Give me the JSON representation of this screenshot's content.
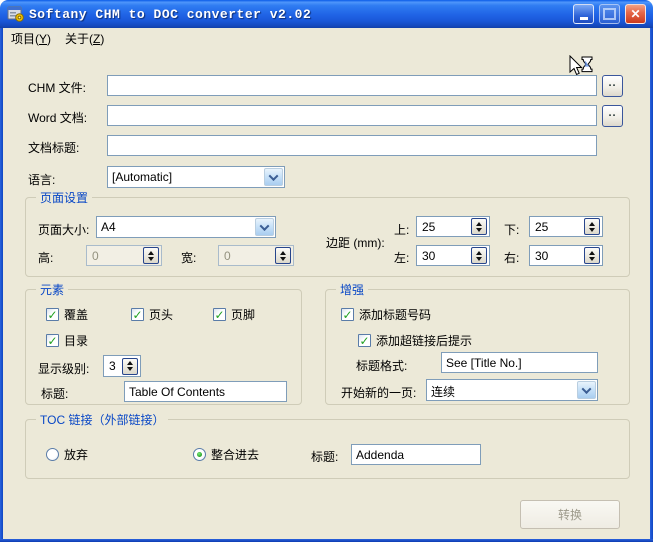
{
  "window": {
    "title": "Softany CHM to DOC converter v2.02"
  },
  "icons": {
    "close": "✕",
    "check": "✓",
    "browse": "..",
    "app_icon": "chm-doc-converter-app",
    "minimize": "minimize",
    "maximize": "maximize",
    "busy_cursor": "arrow-with-hourglass"
  },
  "menu": {
    "items": [
      {
        "pre": "项目(",
        "key": "Y",
        "post": ")"
      },
      {
        "pre": "关于(",
        "key": "Z",
        "post": ")"
      }
    ]
  },
  "fields": {
    "chm": {
      "label": "CHM 文件:",
      "value": "",
      "browse": ".."
    },
    "word": {
      "label": "Word 文档:",
      "value": "",
      "browse": ".."
    },
    "doc_title": {
      "label": "文档标题:",
      "value": ""
    },
    "language": {
      "label": "语言:",
      "value": "[Automatic]"
    }
  },
  "page_setup": {
    "title": "页面设置",
    "page_size": {
      "label": "页面大小:",
      "value": "A4"
    },
    "height": {
      "label": "高:",
      "value": "0",
      "enabled": false
    },
    "width": {
      "label": "宽:",
      "value": "0",
      "enabled": false
    },
    "margins": {
      "label": "边距 (mm):",
      "top": {
        "label": "上:",
        "value": "25"
      },
      "bottom": {
        "label": "下:",
        "value": "25"
      },
      "left": {
        "label": "左:",
        "value": "30"
      },
      "right": {
        "label": "右:",
        "value": "30"
      }
    }
  },
  "elements": {
    "title": "元素",
    "checkboxes": [
      {
        "label": "覆盖",
        "checked": true
      },
      {
        "label": "页头",
        "checked": true
      },
      {
        "label": "页脚",
        "checked": true
      },
      {
        "label": "目录",
        "checked": true
      }
    ],
    "display_level": {
      "label": "显示级别:",
      "value": "3"
    },
    "toc_title": {
      "label": "标题:",
      "value": "Table Of Contents"
    }
  },
  "enhance": {
    "title": "增强",
    "add_title_number": {
      "label": "添加标题号码",
      "checked": true
    },
    "add_hyperlink_tip": {
      "label": "添加超链接后提示",
      "checked": true
    },
    "title_format": {
      "label": "标题格式:",
      "value": "See [Title No.]"
    },
    "start_new_page": {
      "label": "开始新的一页:",
      "value": "连续"
    }
  },
  "toc_link": {
    "title": "TOC 链接（外部链接）",
    "options": [
      {
        "label": "放弃",
        "selected": false
      },
      {
        "label": "整合进去",
        "selected": true
      }
    ],
    "caption": {
      "label": "标题:",
      "value": "Addenda"
    }
  },
  "convert": {
    "label": "转换",
    "enabled": false
  },
  "colors": {
    "window_bg": "#ECE9D8",
    "titlebar_blue": "#2064E6",
    "border_blue": "#0F46C2",
    "group_title_blue": "#0847C6",
    "input_border": "#7F9DB9",
    "check_green": "#21A121",
    "disabled_text": "#9D9A8B"
  }
}
